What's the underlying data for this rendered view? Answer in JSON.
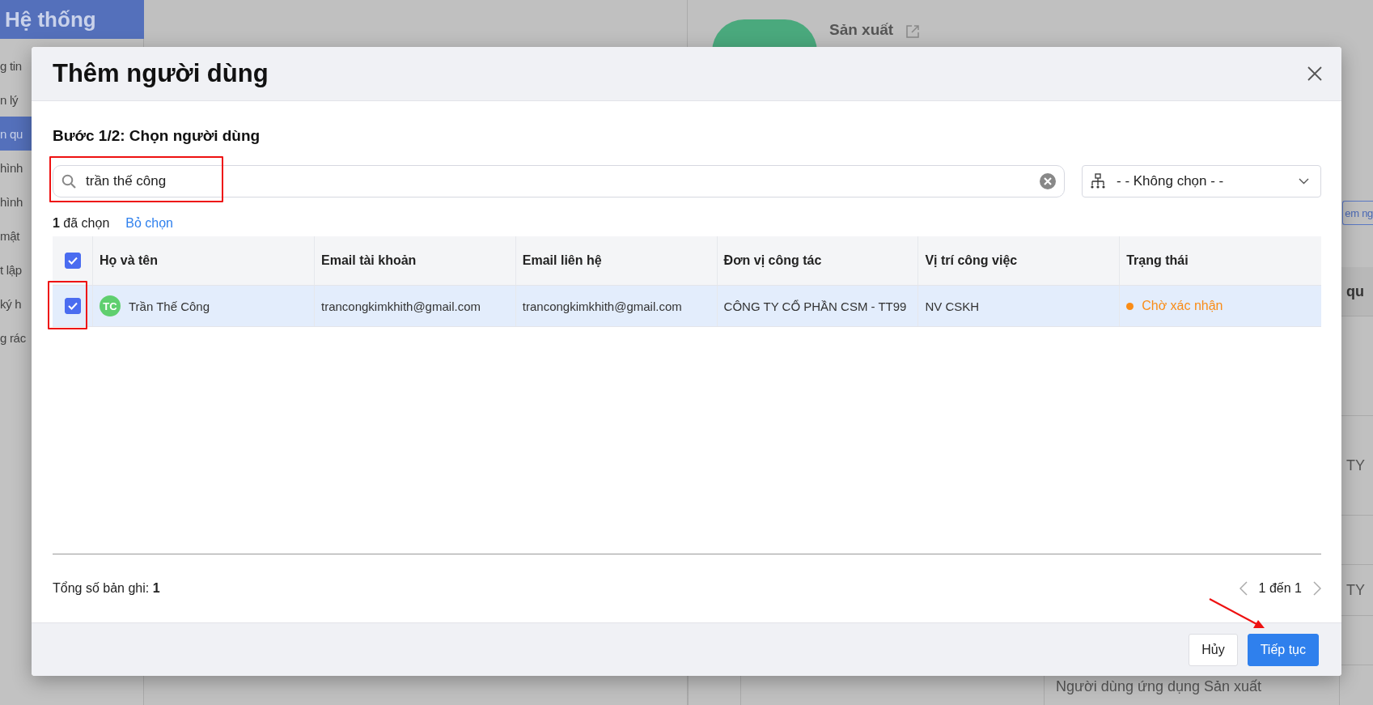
{
  "background": {
    "header_title": "Hệ thống",
    "sidebar": [
      {
        "label": "g tin",
        "selected": false
      },
      {
        "label": "n lý",
        "selected": false
      },
      {
        "label": "n qu",
        "selected": true
      },
      {
        "label": "hình",
        "selected": false
      },
      {
        "label": "hình",
        "selected": false
      },
      {
        "label": "mật",
        "selected": false
      },
      {
        "label": "t lập",
        "selected": false
      },
      {
        "label": "ký h",
        "selected": false
      },
      {
        "label": "g rác",
        "selected": false
      }
    ],
    "app_title": "Sản xuất",
    "add_button": "em ng",
    "table": {
      "column_4": "qu",
      "rows": [
        {},
        {
          "column_4": "TY"
        },
        {},
        {
          "column_4": "TY"
        },
        {},
        {
          "column_3": "Người dùng ứng dụng Sản xuất"
        }
      ]
    }
  },
  "modal": {
    "title": "Thêm người dùng",
    "step_title": "Bước 1/2: Chọn người dùng",
    "search": {
      "value": "trần thế công"
    },
    "unit_select": {
      "value": "- - Không chọn - -"
    },
    "selected_count": "**1** đã chọn",
    "clear_selection": "Bỏ chọn",
    "table": {
      "select_all": {
        "checked": true
      },
      "columns": [
        "Họ và tên",
        "Email tài khoản",
        "Email liên hệ",
        "Đơn vị công tác",
        "Vị trí công việc",
        "Trạng thái"
      ],
      "rows": [
        {
          "selected": true,
          "avatar": {
            "initials": "TC",
            "color": "#5fcf6f"
          },
          "name": "Trần Thế Công",
          "account_email": "trancongkimkhith@gmail.com",
          "contact_email": "trancongkimkhith@gmail.com",
          "unit": "CÔNG TY CỔ PHẦN CSM - TT99",
          "position": "NV CSKH",
          "status": {
            "label": "Chờ xác nhận",
            "color": "#fa8c16"
          }
        }
      ]
    },
    "total": "Tổng số bản ghi: **1**",
    "pagination": "1 đến 1",
    "buttons": [
      {
        "kind": "secondary",
        "label": "Hủy"
      },
      {
        "kind": "primary",
        "label": "Tiếp tục"
      }
    ]
  }
}
